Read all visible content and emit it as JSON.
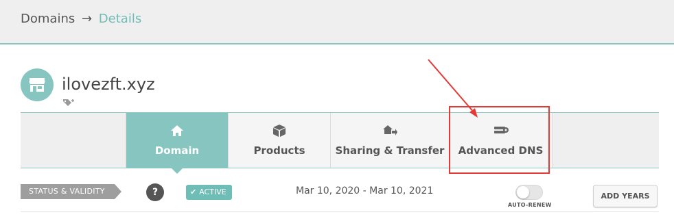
{
  "breadcrumb": {
    "root": "Domains",
    "separator": "→",
    "current": "Details"
  },
  "domain": {
    "name": "ilovezft.xyz",
    "avatar_icon": "storefront-icon",
    "tag_icon": "tag-add-icon"
  },
  "tabs": [
    {
      "label": "Domain",
      "icon": "home-icon",
      "active": true
    },
    {
      "label": "Products",
      "icon": "box-icon",
      "active": false
    },
    {
      "label": "Sharing & Transfer",
      "icon": "transfer-icon",
      "active": false
    },
    {
      "label": "Advanced DNS",
      "icon": "server-gear-icon",
      "active": false
    }
  ],
  "status": {
    "section_label": "STATUS & VALIDITY",
    "help_icon_text": "?",
    "badge": "ACTIVE",
    "dates": "Mar 10, 2020 - Mar 10, 2021",
    "auto_renew_label": "AUTO-RENEW",
    "auto_renew_on": false,
    "add_years_label": "ADD YEARS"
  },
  "colors": {
    "accent": "#86c5c0",
    "highlight": "#e53935",
    "header_bg": "#efefef"
  }
}
